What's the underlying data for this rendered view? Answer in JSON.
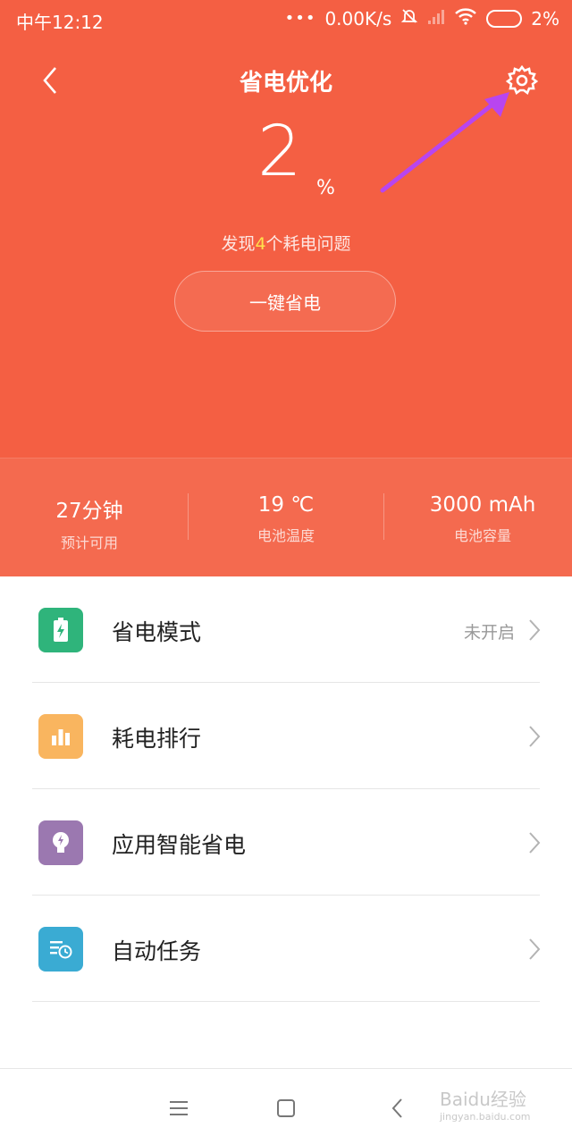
{
  "status_bar": {
    "time": "中午12:12",
    "dots": "•••",
    "network_speed": "0.00K/s",
    "battery_percent": "2%",
    "icons": [
      "mute-bell-icon",
      "signal-icon",
      "wifi-icon",
      "battery-icon"
    ]
  },
  "header": {
    "title": "省电优化",
    "back_icon": "chevron-left-icon",
    "settings_icon": "gear-icon"
  },
  "battery": {
    "level": "2",
    "unit": "%",
    "issues_prefix": "发现",
    "issues_count": "4",
    "issues_suffix": "个耗电问题",
    "optimize_button": "一键省电"
  },
  "stats": [
    {
      "value": "27分钟",
      "label": "预计可用"
    },
    {
      "value": "19 ℃",
      "label": "电池温度"
    },
    {
      "value": "3000 mAh",
      "label": "电池容量"
    }
  ],
  "menu": [
    {
      "label": "省电模式",
      "value": "未开启",
      "icon": "battery-charge-icon",
      "color": "#2fb47b"
    },
    {
      "label": "耗电排行",
      "value": "",
      "icon": "bar-chart-icon",
      "color": "#f9b55f"
    },
    {
      "label": "应用智能省电",
      "value": "",
      "icon": "lightbulb-icon",
      "color": "#9b78b0"
    },
    {
      "label": "自动任务",
      "value": "",
      "icon": "clock-list-icon",
      "color": "#3aabd3"
    }
  ],
  "navbar": {
    "watermark": "Baidu经验",
    "watermark_sub": "jingyan.baidu.com"
  },
  "colors": {
    "primary": "#f45f43",
    "highlight": "#ffe14d"
  }
}
